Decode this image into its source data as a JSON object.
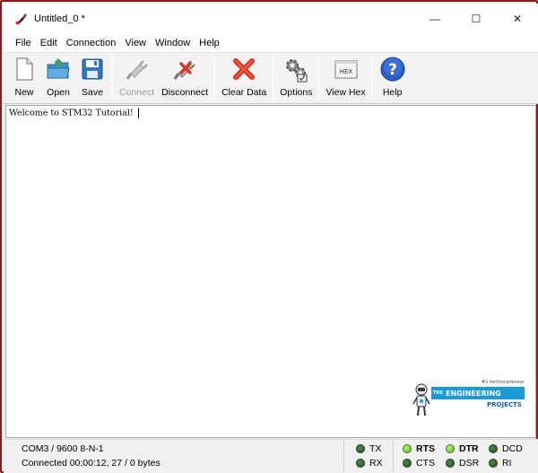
{
  "window": {
    "title": "Untitled_0 *",
    "controls": {
      "minimize": "—",
      "maximize": "☐",
      "close": "✕"
    }
  },
  "menu": [
    "File",
    "Edit",
    "Connection",
    "View",
    "Window",
    "Help"
  ],
  "toolbar": {
    "new": "New",
    "open": "Open",
    "save": "Save",
    "connect": "Connect",
    "disconnect": "Disconnect",
    "clear_data": "Clear Data",
    "options": "Options",
    "view_hex": "View Hex",
    "view_hex_badge": "HEX",
    "help": "Help"
  },
  "terminal": {
    "text": "Welcome to STM32 Tutorial!"
  },
  "logo": {
    "tagline": "#1 techno-preneur",
    "the": "THE",
    "name": "ENGINEERING",
    "sub": "PROJECTS"
  },
  "status": {
    "port": "COM3 / 9600 8-N-1",
    "connection": "Connected 00:00:12, 27 / 0 bytes"
  },
  "signals": {
    "tx": "TX",
    "rx": "RX",
    "rts": "RTS",
    "cts": "CTS",
    "dtr": "DTR",
    "dsr": "DSR",
    "dcd": "DCD",
    "ri": "RI"
  },
  "colors": {
    "frame_border": "#8b1a1a",
    "led_on": "#7fd63a",
    "led_off": "#2e6b2e",
    "logo_blue": "#1a9ad6"
  }
}
